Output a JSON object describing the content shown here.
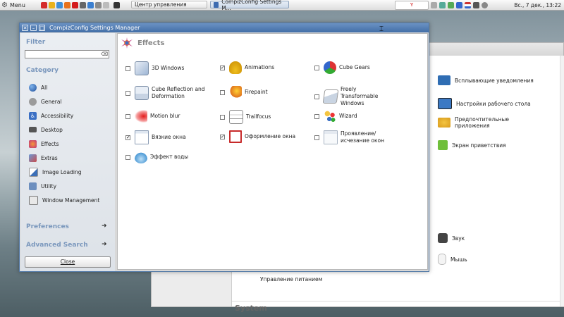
{
  "top_panel": {
    "menu_label": "Menu",
    "tasks": [
      {
        "label": "Центр управления"
      },
      {
        "label": "CompizConfig Settings M..."
      }
    ],
    "clock": "Вс., 7 дек., 13:22"
  },
  "bg_window": {
    "items": [
      {
        "label": "Всплывающие уведомления"
      },
      {
        "label": "Настройки рабочего стола"
      },
      {
        "label": "Предпочтительные приложения"
      },
      {
        "label": "Экран приветствия"
      },
      {
        "label": "Звук"
      },
      {
        "label": "Мышь"
      },
      {
        "label": "Управление питанием"
      }
    ],
    "section_system": "System"
  },
  "ccsm": {
    "title": "CompizConfig Settings Manager",
    "sidebar": {
      "filter_label": "Filter",
      "filter_value": "",
      "category_label": "Category",
      "categories": [
        {
          "label": "All"
        },
        {
          "label": "General"
        },
        {
          "label": "Accessibility"
        },
        {
          "label": "Desktop"
        },
        {
          "label": "Effects"
        },
        {
          "label": "Extras"
        },
        {
          "label": "Image Loading"
        },
        {
          "label": "Utility"
        },
        {
          "label": "Window Management"
        }
      ],
      "preferences_label": "Preferences",
      "advanced_search_label": "Advanced Search",
      "close_label": "Close"
    },
    "section_title": "Effects",
    "plugins": [
      {
        "label": "3D Windows",
        "checked": false
      },
      {
        "label": "Animations",
        "checked": true
      },
      {
        "label": "Cube Gears",
        "checked": false
      },
      {
        "label": "Cube Reflection and Deformation",
        "checked": false
      },
      {
        "label": "Firepaint",
        "checked": false
      },
      {
        "label": "Freely Transformable Windows",
        "checked": false
      },
      {
        "label": "Motion blur",
        "checked": false
      },
      {
        "label": "Trailfocus",
        "checked": false
      },
      {
        "label": "Wizard",
        "checked": false
      },
      {
        "label": "Вязкие окна",
        "checked": true
      },
      {
        "label": "Оформление окна",
        "checked": true
      },
      {
        "label": "Проявление/ исчезание окон",
        "checked": false
      },
      {
        "label": "Эффект воды",
        "checked": false
      }
    ]
  },
  "colors": {
    "titlebar": "#426ea7",
    "sidebar_heading": "#7b98bd",
    "section_title": "#888888"
  }
}
